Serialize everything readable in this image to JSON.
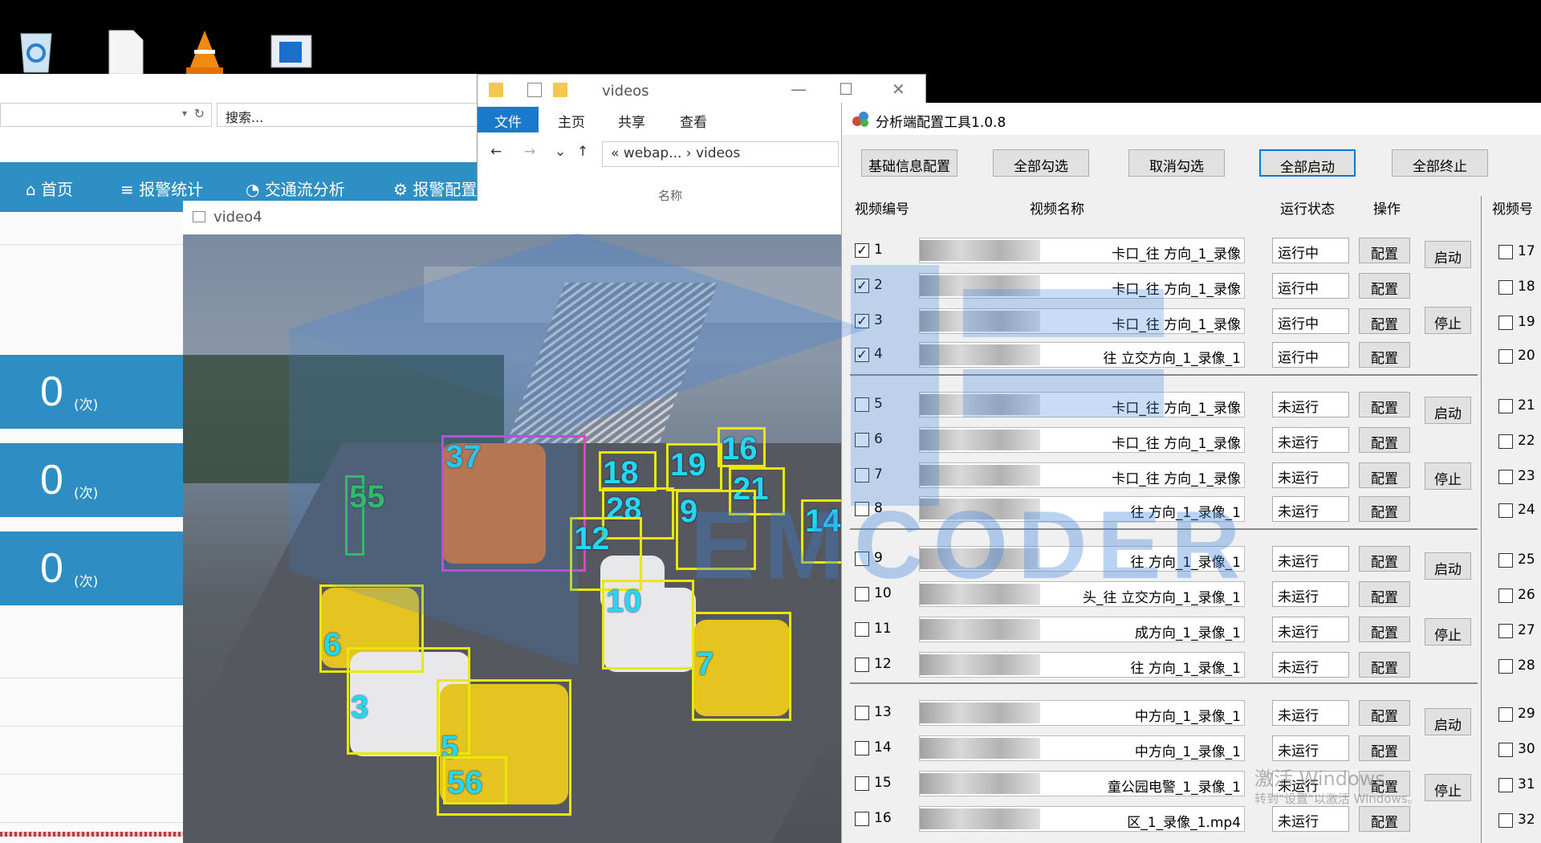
{
  "browser": {
    "search_placeholder": "搜索...",
    "nav": [
      "首页",
      "报警统计",
      "交通流分析",
      "报警配置"
    ],
    "stats": [
      {
        "value": "0",
        "unit": "(次)"
      },
      {
        "value": "0",
        "unit": "(次)"
      },
      {
        "value": "0",
        "unit": "(次)"
      }
    ]
  },
  "explorer": {
    "title": "videos",
    "ribbon": [
      "文件",
      "主页",
      "共享",
      "查看"
    ],
    "path": "« webap... › videos",
    "column": "名称"
  },
  "video": {
    "title": "video4",
    "detections": [
      {
        "label": "37",
        "color": "magenta"
      },
      {
        "label": "55",
        "color": "green"
      },
      {
        "label": "18"
      },
      {
        "label": "19"
      },
      {
        "label": "16"
      },
      {
        "label": "21"
      },
      {
        "label": "28"
      },
      {
        "label": "9"
      },
      {
        "label": "12"
      },
      {
        "label": "14"
      },
      {
        "label": "10"
      },
      {
        "label": "6"
      },
      {
        "label": "3"
      },
      {
        "label": "7"
      },
      {
        "label": "5"
      },
      {
        "label": "56"
      }
    ],
    "watermark": "EMCODER"
  },
  "config": {
    "title": "分析端配置工具1.0.8",
    "toolbar": [
      "基础信息配置",
      "全部勾选",
      "取消勾选",
      "全部启动",
      "全部终止"
    ],
    "headers": [
      "视频编号",
      "视频名称",
      "运行状态",
      "操作",
      "视频号"
    ],
    "config_label": "配置",
    "start_label": "启动",
    "stop_label": "停止",
    "rows": [
      {
        "id": "1",
        "checked": true,
        "name": "卡口_往      方向_1_录像",
        "status": "运行中"
      },
      {
        "id": "2",
        "checked": true,
        "name": "卡口_往      方向_1_录像",
        "status": "运行中"
      },
      {
        "id": "3",
        "checked": true,
        "name": "卡口_往      方向_1_录像",
        "status": "运行中"
      },
      {
        "id": "4",
        "checked": true,
        "name": "往   立交方向_1_录像_1",
        "status": "运行中"
      },
      {
        "id": "5",
        "checked": false,
        "name": "卡口_往      方向_1_录像",
        "status": "未运行"
      },
      {
        "id": "6",
        "checked": false,
        "name": "卡口_往      方向_1_录像",
        "status": "未运行"
      },
      {
        "id": "7",
        "checked": false,
        "name": "卡口_往      方向_1_录像",
        "status": "未运行"
      },
      {
        "id": "8",
        "checked": false,
        "name": "往      方向_1_录像_1",
        "status": "未运行"
      },
      {
        "id": "9",
        "checked": false,
        "name": "往   方向_1_录像_1",
        "status": "未运行"
      },
      {
        "id": "10",
        "checked": false,
        "name": "头_往   立交方向_1_录像_1",
        "status": "未运行"
      },
      {
        "id": "11",
        "checked": false,
        "name": "成方向_1_录像_1",
        "status": "未运行"
      },
      {
        "id": "12",
        "checked": false,
        "name": "往   方向_1_录像_1",
        "status": "未运行"
      },
      {
        "id": "13",
        "checked": false,
        "name": "中方向_1_录像_1",
        "status": "未运行"
      },
      {
        "id": "14",
        "checked": false,
        "name": "中方向_1_录像_1",
        "status": "未运行"
      },
      {
        "id": "15",
        "checked": false,
        "name": "童公园电警_1_录像_1",
        "status": "未运行"
      },
      {
        "id": "16",
        "checked": false,
        "name": "区_1_录像_1.mp4",
        "status": "未运行"
      }
    ],
    "right_ids": [
      "17",
      "18",
      "19",
      "20",
      "21",
      "22",
      "23",
      "24",
      "25",
      "26",
      "27",
      "28",
      "29",
      "30",
      "31",
      "32"
    ],
    "activate_line1": "激活 Windows",
    "activate_line2": "转到\"设置\"以激活 Windows。"
  }
}
